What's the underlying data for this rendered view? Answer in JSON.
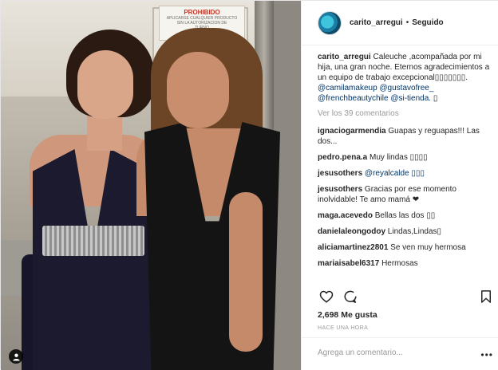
{
  "post": {
    "photo_sign": {
      "title": "PROHIBIDO",
      "line1": "APLICARSE CUALQUIER PRODUCTO",
      "line2": "SIN LA AUTORIZACION DE",
      "line3": "TURNO"
    }
  },
  "header": {
    "username": "carito_arregui",
    "separator": "•",
    "follow_status": "Seguido"
  },
  "caption": {
    "username": "carito_arregui",
    "text": "Caleuche ,acompañada por mi hija, una gran noche. Eternos agradecimientos a un equipo de trabajo excepcional▯▯▯▯▯▯▯.",
    "tags": [
      "@camilamakeup",
      "@gustavofree_",
      "@frenchbeautychile",
      "@si-tienda."
    ],
    "trailing": " ▯"
  },
  "view_all_comments": "Ver los 39 comentarios",
  "comments": [
    {
      "user": "ignaciogarmendia",
      "text": "Guapas y reguapas!!! Las dos..."
    },
    {
      "user": "pedro.pena.a",
      "text": "Muy lindas ▯▯▯▯"
    },
    {
      "user": "jesusothers",
      "text": "@reyalcalde ▯▯▯",
      "is_tag": true
    },
    {
      "user": "jesusothers",
      "text": "Gracias por ese momento inolvidable! Te amo mamá ❤"
    },
    {
      "user": "maga.acevedo",
      "text": "Bellas las dos ▯▯"
    },
    {
      "user": "danielaleongodoy",
      "text": "Lindas,Lindas▯"
    },
    {
      "user": "aliciamartinez2801",
      "text": "Se ven muy hermosa"
    },
    {
      "user": "mariaisabel6317",
      "text": "Hermosas"
    }
  ],
  "actions": {
    "like_icon": "heart-icon",
    "comment_icon": "comment-bubble-icon",
    "save_icon": "bookmark-icon"
  },
  "likes": "2,698 Me gusta",
  "timestamp": "HACE UNA HORA",
  "add_comment": {
    "placeholder": "Agrega un comentario...",
    "more_label": "•••"
  },
  "colors": {
    "text": "#262626",
    "muted": "#999999",
    "link": "#003569",
    "border": "#efefef"
  }
}
